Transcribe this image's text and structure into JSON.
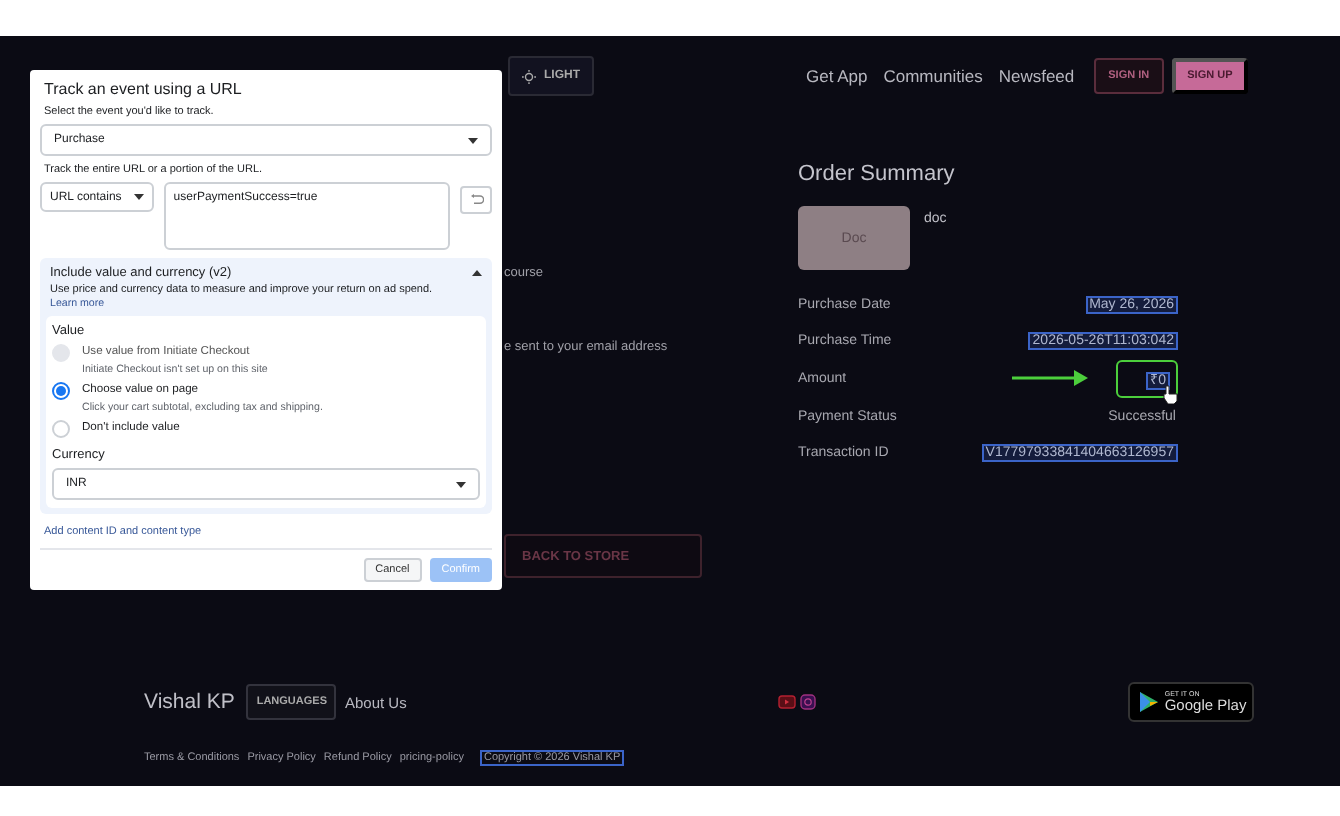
{
  "page_header": {
    "theme_button": "LIGHT",
    "nav_links": [
      "Get App",
      "Communities",
      "Newsfeed"
    ],
    "sign_in": "SIGN IN",
    "sign_up": "SIGN UP"
  },
  "background_text": [
    "course",
    "e sent to your email address"
  ],
  "back_button": "BACK TO STORE",
  "order_summary": {
    "title": "Order Summary",
    "product": {
      "thumbnail": "Doc",
      "name": "doc"
    },
    "rows": [
      {
        "label": "Purchase Date",
        "value": "May 26, 2026",
        "highlighted": true,
        "pointed": false
      },
      {
        "label": "Purchase Time",
        "value": "2026-05-26T11:03:042",
        "highlighted": true,
        "pointed": false
      },
      {
        "label": "Amount",
        "value": "₹0",
        "highlighted": true,
        "pointed": true
      },
      {
        "label": "Payment Status",
        "value": "Successful",
        "highlighted": false,
        "pointed": false
      },
      {
        "label": "Transaction ID",
        "value": "V17797933841404663126957",
        "highlighted": true,
        "pointed": false
      }
    ]
  },
  "footer": {
    "brand": "Vishal KP",
    "languages_button": "LANGUAGES",
    "about": "About Us",
    "store_badge": {
      "small": "GET IT ON",
      "large": "Google Play"
    },
    "links": [
      "Terms & Conditions",
      "Privacy Policy",
      "Refund Policy",
      "pricing-policy"
    ],
    "copyright": {
      "text": "Copyright © 2026 Vishal KP",
      "highlighted": true
    }
  },
  "dialog": {
    "title": "Track an event using a URL",
    "event_label": "Select the event you'd like to track.",
    "event": "Purchase",
    "url_label": "Track the entire URL or a portion of the URL.",
    "match_type": "URL contains",
    "url_value": "userPaymentSuccess=true",
    "section": {
      "title": "Include value and currency (v2)",
      "expanded": true,
      "description": "Use price and currency data to measure and improve your return on ad spend.",
      "link": "Learn more",
      "value_label": "Value",
      "options": [
        {
          "label": "Use value from Initiate Checkout",
          "hint": "Initiate Checkout isn't set up on this site",
          "selected": false,
          "disabled": true
        },
        {
          "label": "Choose value on page",
          "hint": "Click your cart subtotal, excluding tax and shipping.",
          "selected": true,
          "disabled": false
        },
        {
          "label": "Don't include value",
          "selected": false,
          "disabled": false
        }
      ],
      "currency_label": "Currency",
      "currency": "INR"
    },
    "add_link": "Add content ID and content type",
    "buttons": [
      {
        "label": "Cancel",
        "kind": "secondary",
        "disabled": false
      },
      {
        "label": "Confirm",
        "kind": "primary",
        "disabled": true
      }
    ]
  }
}
